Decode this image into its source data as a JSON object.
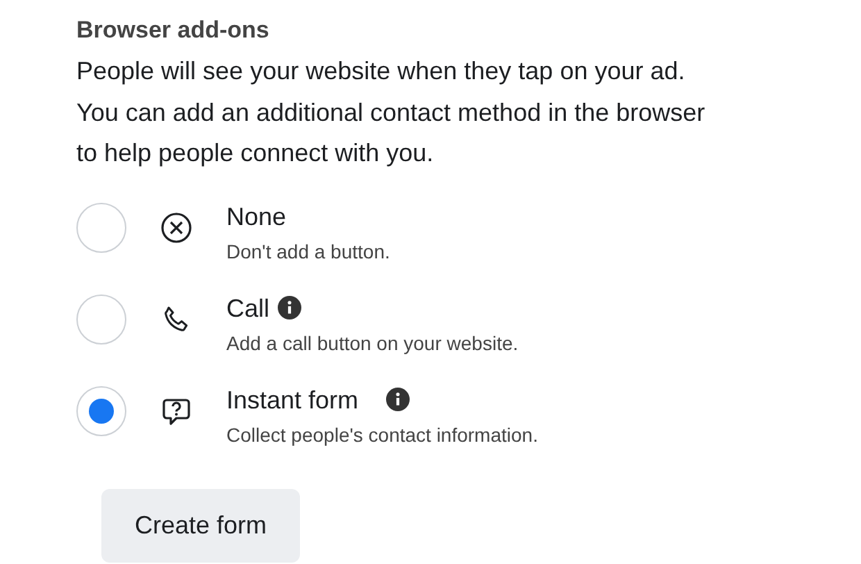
{
  "title": "Browser add-ons",
  "description_lines": [
    "People will see your website when they tap on your ad.",
    "You can add an additional contact method in the browser",
    "to help people connect with you."
  ],
  "options": [
    {
      "label": "None",
      "description": "Don't add a button.",
      "kind": "none",
      "info": false,
      "selected": false
    },
    {
      "label": "Call",
      "description": "Add a call button on your website.",
      "kind": "call",
      "info": true,
      "selected": false
    },
    {
      "label": "Instant form",
      "description": "Collect people's contact information.",
      "kind": "form",
      "info": true,
      "selected": true
    }
  ],
  "button": "Create form"
}
